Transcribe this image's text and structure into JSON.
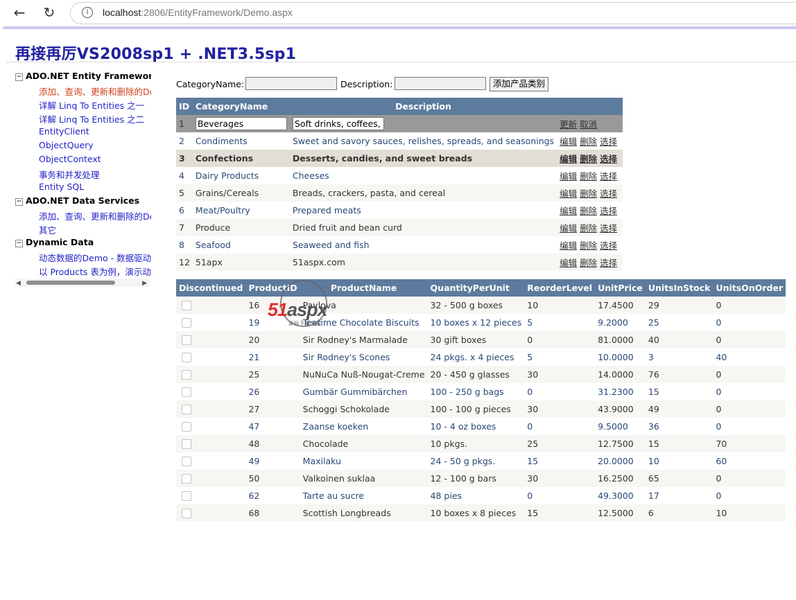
{
  "browser": {
    "url_host": "localhost",
    "url_rest": ":2806/EntityFramework/Demo.aspx",
    "back_icon": "back-arrow-icon",
    "reload_icon": "reload-icon",
    "info_icon": "info-icon"
  },
  "page_title": "再接再厉VS2008sp1 + .NET3.5sp1",
  "tree": {
    "sections": [
      {
        "title": "ADO.NET Entity Framework",
        "toggle": "−"
      },
      {
        "title": "ADO.NET Data Services",
        "toggle": "−"
      },
      {
        "title": "Dynamic Data",
        "toggle": "−"
      }
    ],
    "links": [
      "添加、查询、更新和删除的Demo",
      "详解 Linq To Entities 之一",
      "详解 Linq To Entities 之二",
      "EntityClient",
      "ObjectQuery",
      "ObjectContext",
      "事务和并发处理",
      "Entity SQL",
      "添加、查询、更新和删除的Demo",
      "其它",
      "动态数据的Demo - 数据驱动的Web应用程序",
      "以 Products 表为例，演示动态数据"
    ]
  },
  "form": {
    "category_label": "CategoryName:",
    "description_label": "Description:",
    "add_button": "添加产品类别",
    "category_value": "",
    "description_value": ""
  },
  "categories": {
    "headers": [
      "ID",
      "CategoryName",
      "Description",
      ""
    ],
    "commands": {
      "edit": "编辑",
      "delete": "删除",
      "select": "选择",
      "update": "更新",
      "cancel": "取消"
    },
    "rows": [
      {
        "id": "1",
        "name": "Beverages",
        "desc": "Soft drinks, coffees, tea"
      },
      {
        "id": "2",
        "name": "Condiments",
        "desc": "Sweet and savory sauces, relishes, spreads, and seasonings"
      },
      {
        "id": "3",
        "name": "Confections",
        "desc": "Desserts, candies, and sweet breads"
      },
      {
        "id": "4",
        "name": "Dairy Products",
        "desc": "Cheeses"
      },
      {
        "id": "5",
        "name": "Grains/Cereals",
        "desc": "Breads, crackers, pasta, and cereal"
      },
      {
        "id": "6",
        "name": "Meat/Poultry",
        "desc": "Prepared meats"
      },
      {
        "id": "7",
        "name": "Produce",
        "desc": "Dried fruit and bean curd"
      },
      {
        "id": "8",
        "name": "Seafood",
        "desc": "Seaweed and fish"
      },
      {
        "id": "12",
        "name": "51apx",
        "desc": "51aspx.com"
      }
    ]
  },
  "products": {
    "headers": [
      "Discontinued",
      "ProductID",
      "ProductName",
      "QuantityPerUnit",
      "ReorderLevel",
      "UnitPrice",
      "UnitsInStock",
      "UnitsOnOrder"
    ],
    "rows": [
      [
        "16",
        "Pavlova",
        "32 - 500 g boxes",
        "10",
        "17.4500",
        "29",
        "0"
      ],
      [
        "19",
        "Teatime Chocolate Biscuits",
        "10 boxes x 12 pieces",
        "5",
        "9.2000",
        "25",
        "0"
      ],
      [
        "20",
        "Sir Rodney's Marmalade",
        "30 gift boxes",
        "0",
        "81.0000",
        "40",
        "0"
      ],
      [
        "21",
        "Sir Rodney's Scones",
        "24 pkgs. x 4 pieces",
        "5",
        "10.0000",
        "3",
        "40"
      ],
      [
        "25",
        "NuNuCa Nuß-Nougat-Creme",
        "20 - 450 g glasses",
        "30",
        "14.0000",
        "76",
        "0"
      ],
      [
        "26",
        "Gumbär Gummibärchen",
        "100 - 250 g bags",
        "0",
        "31.2300",
        "15",
        "0"
      ],
      [
        "27",
        "Schoggi Schokolade",
        "100 - 100 g pieces",
        "30",
        "43.9000",
        "49",
        "0"
      ],
      [
        "47",
        "Zaanse koeken",
        "10 - 4 oz boxes",
        "0",
        "9.5000",
        "36",
        "0"
      ],
      [
        "48",
        "Chocolade",
        "10 pkgs.",
        "25",
        "12.7500",
        "15",
        "70"
      ],
      [
        "49",
        "Maxilaku",
        "24 - 50 g pkgs.",
        "15",
        "20.0000",
        "10",
        "60"
      ],
      [
        "50",
        "Valkoinen suklaa",
        "12 - 100 g bars",
        "30",
        "16.2500",
        "65",
        "0"
      ],
      [
        "62",
        "Tarte au sucre",
        "48 pies",
        "0",
        "49.3000",
        "17",
        "0"
      ],
      [
        "68",
        "Scottish Longbreads",
        "10 boxes x 8 pieces",
        "15",
        "12.5000",
        "6",
        "10"
      ]
    ]
  },
  "watermark": {
    "part1": "51",
    "part2": "aspx",
    "sub": "源码下载专家"
  },
  "colors": {
    "header_bg": "#5d7b9d",
    "title": "#2020a0",
    "link": "#1f1fc7",
    "active_link": "#d23f1a"
  }
}
